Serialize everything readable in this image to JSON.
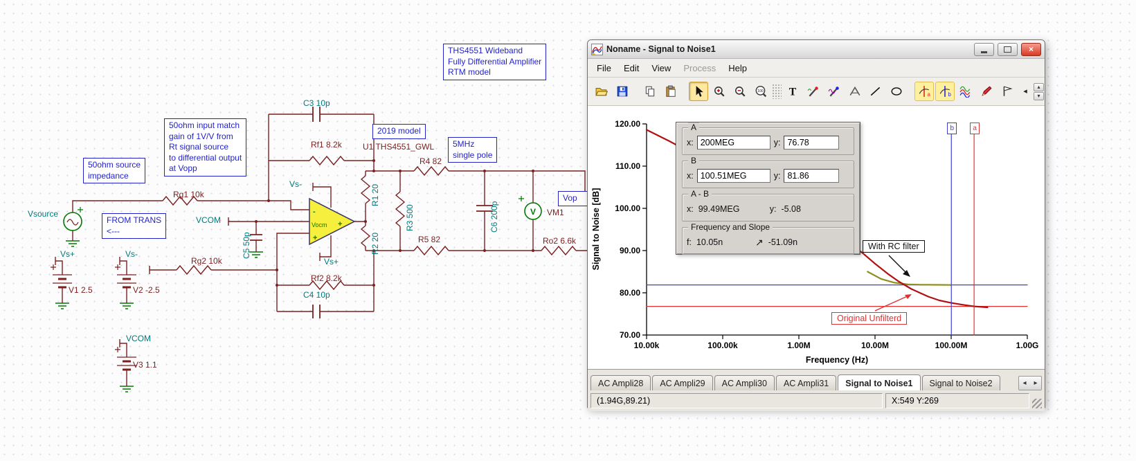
{
  "colors": {
    "wire": "#7b1f1f",
    "label_component": "#7b1f1f",
    "label_net": "#007a7a",
    "annotation_blue": "#2222cc",
    "ground_green": "#007800",
    "curve_red": "#b01010",
    "curve_filtered": "#8f8f1e",
    "cursor_blue": "#3c3cde",
    "cursor_red": "#e03030"
  },
  "schematic": {
    "annotations": {
      "source_impedance": "50ohm source\nimpedance",
      "input_match": "50ohm input match\ngain of 1V/V from\nRt signal source\nto differential output\nat Vopp",
      "ths_model": "THS4551 Wideband\nFully Differential Amplifier\nRTM model",
      "model_2019": "2019 model",
      "single_pole": "5MHz\nsingle pole",
      "from_trans": "FROM TRANS\n<---",
      "vop": "Vop"
    },
    "labels": {
      "vsource": "Vsource",
      "c3": "C3 10p",
      "rf1": "Rf1 8.2k",
      "u1": "U1 THS4551_GWL",
      "r4": "R4 82",
      "rg1": "Rg1 10k",
      "vs_minus_top": "Vs-",
      "r1": "R1 20",
      "r3": "R3 500",
      "c6": "C6 200p",
      "vcom_in": "VCOM",
      "c5": "C5 50p",
      "r2": "R2 20",
      "r5": "R5 82",
      "vm1": "VM1",
      "ro2": "Ro2 6.6k",
      "rg2": "Rg2 10k",
      "vs_plus_amp": "Vs+",
      "rf2": "Rf2 8.2k",
      "c4": "C4 10p",
      "vs_plus_batt": "Vs+",
      "vs_minus_batt": "Vs-",
      "v1": "V1 2.5",
      "v2": "V2 -2.5",
      "vcom_batt": "VCOM",
      "v3": "V3 1.1",
      "opamp_vocm": "Vocm",
      "opamp_minus": "-",
      "opamp_plus": "+",
      "opamp_plus_out": "+",
      "meter_v": "V"
    }
  },
  "window": {
    "title": "Noname - Signal to Noise1",
    "menu": {
      "file": "File",
      "edit": "Edit",
      "view": "View",
      "process": "Process",
      "help": "Help"
    },
    "toolbar": {
      "text_tool": "T",
      "zoom100": "100",
      "cursor_a": "a",
      "cursor_b": "b"
    },
    "glyphs": {
      "close": "×",
      "tab_prev": "◂",
      "tab_next": "▸",
      "spin_up": "▴",
      "spin_down": "▾",
      "nav_back": "◂",
      "slope_arrow": "↗"
    },
    "cursor_panel": {
      "a_title": "A",
      "b_title": "B",
      "ab_title": "A - B",
      "fs_title": "Frequency and Slope",
      "x_label": "x:",
      "y_label": "y:",
      "f_label": "f:",
      "a_x": "200MEG",
      "a_y": "76.78",
      "b_x": "100.51MEG",
      "b_y": "81.86",
      "ab_x": "99.49MEG",
      "ab_y": "-5.08",
      "f_value": "10.05n",
      "slope_value": "-51.09n"
    },
    "chart": {
      "ylabel": "Signal to Noise [dB]",
      "xlabel": "Frequency (Hz)",
      "yticks": [
        "120.00",
        "110.00",
        "100.00",
        "90.00",
        "80.00",
        "70.00"
      ],
      "xticks": [
        "10.00k",
        "100.00k",
        "1.00M",
        "10.00M",
        "100.00M",
        "1.00G"
      ],
      "ann_rc": "With RC filter",
      "ann_orig": "Original Unfilterd",
      "flag_a": "a",
      "flag_b": "b"
    },
    "tabs": [
      "AC Ampli28",
      "AC Ampli29",
      "AC Ampli30",
      "AC Ampli31",
      "Signal to Noise1",
      "Signal to Noise2"
    ],
    "status": {
      "left": "(1.94G,89.21)",
      "right": "X:549 Y:269"
    }
  },
  "chart_data": {
    "type": "line",
    "title": "Signal to Noise1",
    "xlabel": "Frequency (Hz)",
    "ylabel": "Signal to Noise [dB]",
    "x_scale": "log",
    "xlim": [
      10000,
      1000000000
    ],
    "ylim": [
      70,
      120
    ],
    "grid": false,
    "series": [
      {
        "name": "With RC filter",
        "color": "#8f8f1e",
        "points": [
          [
            8000000,
            85.0
          ],
          [
            12000000,
            83.3
          ],
          [
            18000000,
            82.4
          ],
          [
            27000000,
            82.0
          ],
          [
            40000000,
            81.92
          ],
          [
            70000000,
            81.88
          ],
          [
            100510000,
            81.86
          ]
        ]
      },
      {
        "name": "Original Unfilterd",
        "color": "#b01010",
        "points": [
          [
            10000,
            118.6
          ],
          [
            20000,
            115.9
          ],
          [
            40000,
            113.0
          ],
          [
            70000,
            110.9
          ],
          [
            100000,
            109.4
          ],
          [
            200000,
            106.5
          ],
          [
            400000,
            103.5
          ],
          [
            700000,
            101.2
          ],
          [
            1000000,
            99.6
          ],
          [
            2000000,
            96.3
          ],
          [
            4000000,
            92.6
          ],
          [
            7000000,
            89.3
          ],
          [
            10000000,
            86.9
          ],
          [
            15000000,
            84.4
          ],
          [
            20000000,
            82.8
          ],
          [
            30000000,
            80.9
          ],
          [
            50000000,
            79.1
          ],
          [
            70000000,
            78.2
          ],
          [
            100000000,
            77.6
          ],
          [
            150000000,
            77.1
          ],
          [
            200000000,
            76.78
          ],
          [
            300000000,
            76.55
          ]
        ]
      }
    ],
    "cursors": {
      "a": {
        "x": 200000000,
        "y": 76.78,
        "color": "#e03030"
      },
      "b": {
        "x": 100510000,
        "y": 81.86,
        "color": "#3c3cde"
      }
    },
    "hlines": [
      {
        "y": 81.86,
        "color": "#3c3cde"
      },
      {
        "y": 76.78,
        "color": "#e03030"
      }
    ]
  }
}
